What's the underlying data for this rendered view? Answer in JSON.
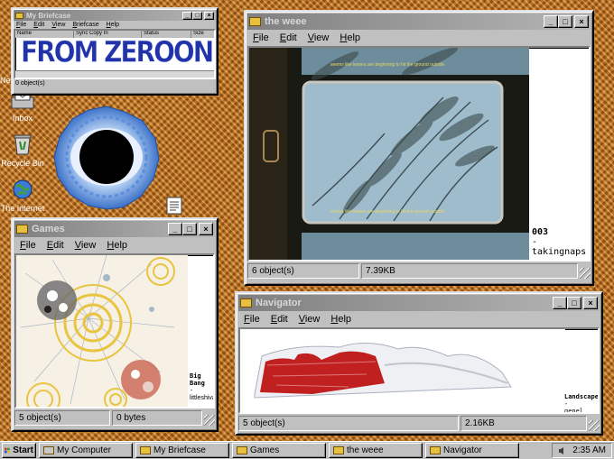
{
  "desktop": {
    "icons": [
      {
        "label": "Inbox",
        "icon": "inbox-icon"
      },
      {
        "label": "Recycle Bin",
        "icon": "recycle-bin-icon"
      },
      {
        "label": "The Internet",
        "icon": "internet-icon"
      }
    ],
    "edge_label": "Ne"
  },
  "briefcase": {
    "title": "My Briefcase",
    "menu": [
      "File",
      "Edit",
      "View",
      "Briefcase",
      "Help"
    ],
    "columns": [
      "Name",
      "Sync Copy In",
      "Status",
      "Size"
    ],
    "banner": "FROM ZEROONE",
    "status": "0 object(s)"
  },
  "weee": {
    "title": "the weee",
    "menu": [
      "File",
      "Edit",
      "View",
      "Help"
    ],
    "film_caption_top": "seems like leaves are beginning to hit the ground outside",
    "film_caption_bottom": "seems like leaves are beginning to hit the ground outside",
    "number": "003",
    "dash": "-",
    "artist": "takingnaps",
    "status_objects": "6 object(s)",
    "status_size": "7.39KB"
  },
  "games": {
    "title": "Games",
    "menu": [
      "File",
      "Edit",
      "View",
      "Help"
    ],
    "art_title_1": "Big",
    "art_title_2": "Bang",
    "dash": "-",
    "artist": "littleshiva",
    "status_objects": "5 object(s)",
    "status_size": "0 bytes"
  },
  "navigator": {
    "title": "Navigator",
    "menu": [
      "File",
      "Edit",
      "View",
      "Help"
    ],
    "art_title": "Landscape",
    "dash": "-",
    "artist": "genel",
    "status_objects": "5 object(s)",
    "status_size": "2.16KB"
  },
  "taskbar": {
    "start": "Start",
    "buttons": [
      "My Computer",
      "My Briefcase",
      "Games",
      "the weee",
      "Navigator"
    ],
    "clock": "2:35 AM"
  },
  "colors": {
    "desktop": "#b86a1c",
    "window_face": "#c0c0c0",
    "banner_text": "#2233aa",
    "landscape_red": "#c02020"
  }
}
